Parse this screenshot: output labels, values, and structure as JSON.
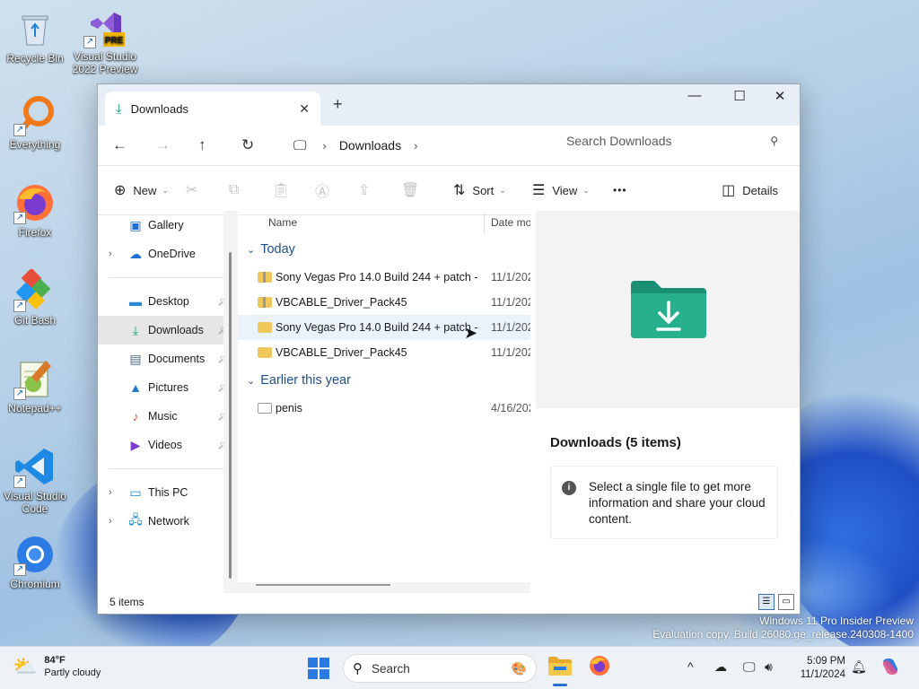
{
  "desktop": {
    "icons": [
      {
        "label": "Recycle Bin"
      },
      {
        "label": "Visual Studio 2022 Preview",
        "badge": "PRE"
      },
      {
        "label": "Everything"
      },
      {
        "label": "Firefox"
      },
      {
        "label": "Git Bash"
      },
      {
        "label": "Notepad++"
      },
      {
        "label": "Visual Studio Code"
      },
      {
        "label": "Chromium"
      }
    ],
    "watermark_line1": "Windows 11 Pro Insider Preview",
    "watermark_line2": "Evaluation copy. Build 26080.ge_release.240308-1400"
  },
  "window": {
    "tab_title": "Downloads",
    "address": {
      "crumb": "Downloads"
    },
    "search_placeholder": "Search Downloads",
    "commands": {
      "new": "New",
      "sort": "Sort",
      "view": "View",
      "more": "•••",
      "details": "Details"
    },
    "sidebar": {
      "items": [
        {
          "label": "Gallery"
        },
        {
          "label": "OneDrive"
        },
        {
          "label": "Desktop"
        },
        {
          "label": "Downloads"
        },
        {
          "label": "Documents"
        },
        {
          "label": "Pictures"
        },
        {
          "label": "Music"
        },
        {
          "label": "Videos"
        },
        {
          "label": "This PC"
        },
        {
          "label": "Network"
        }
      ]
    },
    "columns": {
      "name": "Name",
      "date": "Date mo"
    },
    "groups": [
      {
        "label": "Today",
        "files": [
          {
            "name": "Sony Vegas Pro 14.0 Build 244 + patch - ...",
            "date": "11/1/202"
          },
          {
            "name": "VBCABLE_Driver_Pack45",
            "date": "11/1/202"
          },
          {
            "name": "Sony Vegas Pro 14.0 Build 244 + patch - ...",
            "date": "11/1/202"
          },
          {
            "name": "VBCABLE_Driver_Pack45",
            "date": "11/1/202"
          }
        ]
      },
      {
        "label": "Earlier this year",
        "files": [
          {
            "name": "penis",
            "date": "4/16/202"
          }
        ]
      }
    ],
    "details_pane": {
      "title": "Downloads (5 items)",
      "message": "Select a single file to get more information and share your cloud content."
    },
    "status": "5 items"
  },
  "taskbar": {
    "weather": {
      "temp": "84°F",
      "desc": "Partly cloudy"
    },
    "search_label": "Search",
    "time": "5:09 PM",
    "date": "11/1/2024"
  },
  "colors": {
    "accent": "#2a7ae2",
    "folder": "#f0c75a",
    "group_text": "#1f4f8a"
  }
}
